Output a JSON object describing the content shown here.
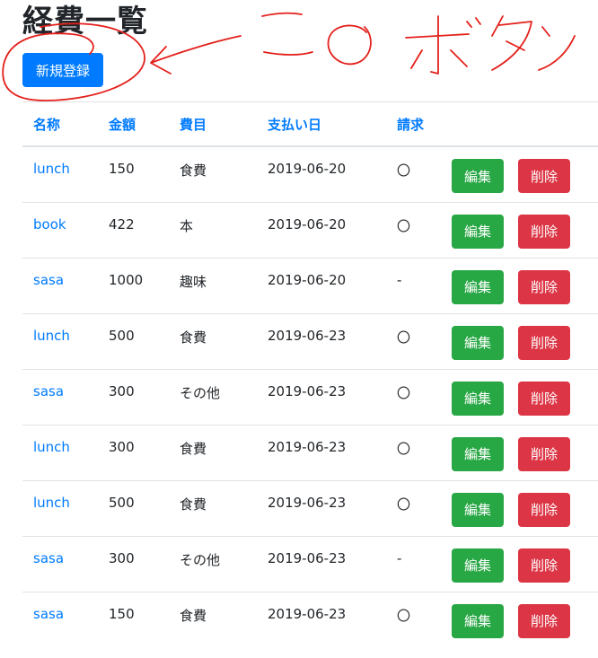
{
  "page": {
    "title": "経費一覧",
    "new_button_label": "新規登録"
  },
  "annotation": {
    "text": "このボタン"
  },
  "table": {
    "headers": [
      "名称",
      "金額",
      "費目",
      "支払い日",
      "請求",
      ""
    ],
    "edit_label": "編集",
    "delete_label": "削除",
    "rows": [
      {
        "name": "lunch",
        "amount": "150",
        "category": "食費",
        "date": "2019-06-20",
        "billed": "〇"
      },
      {
        "name": "book",
        "amount": "422",
        "category": "本",
        "date": "2019-06-20",
        "billed": "〇"
      },
      {
        "name": "sasa",
        "amount": "1000",
        "category": "趣味",
        "date": "2019-06-20",
        "billed": "-"
      },
      {
        "name": "lunch",
        "amount": "500",
        "category": "食費",
        "date": "2019-06-23",
        "billed": "〇"
      },
      {
        "name": "sasa",
        "amount": "300",
        "category": "その他",
        "date": "2019-06-23",
        "billed": "〇"
      },
      {
        "name": "lunch",
        "amount": "300",
        "category": "食費",
        "date": "2019-06-23",
        "billed": "〇"
      },
      {
        "name": "lunch",
        "amount": "500",
        "category": "食費",
        "date": "2019-06-23",
        "billed": "〇"
      },
      {
        "name": "sasa",
        "amount": "300",
        "category": "その他",
        "date": "2019-06-23",
        "billed": "-"
      },
      {
        "name": "sasa",
        "amount": "150",
        "category": "食費",
        "date": "2019-06-23",
        "billed": "〇"
      }
    ]
  },
  "colors": {
    "primary": "#007bff",
    "success": "#28a745",
    "danger": "#dc3545",
    "annotation_red": "#e3201b"
  }
}
